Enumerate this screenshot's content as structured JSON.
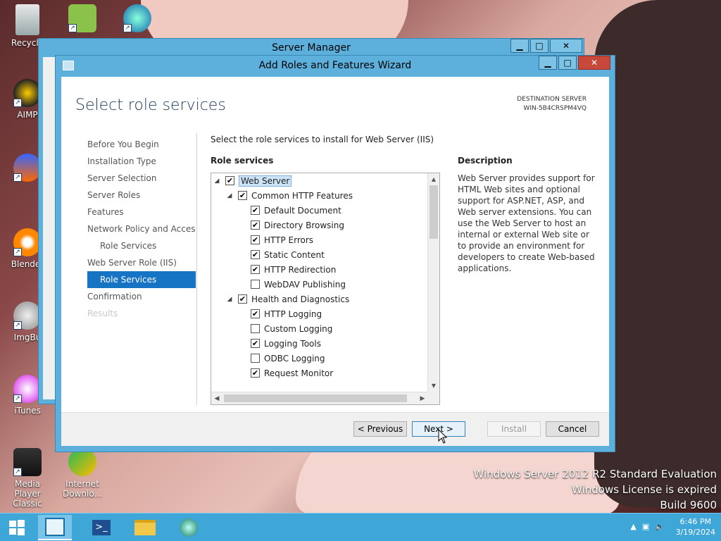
{
  "desktop": {
    "icons": [
      {
        "label": "Recycle",
        "icon": "recycle-bin-icon"
      },
      {
        "label": "AIMP",
        "icon": "aimp-icon"
      },
      {
        "label": "",
        "icon": "audacity-icon"
      },
      {
        "label": "Blender",
        "icon": "blender-icon"
      },
      {
        "label": "ImgBu",
        "icon": "imgburn-icon"
      },
      {
        "label": "iTunes",
        "icon": "itunes-icon"
      },
      {
        "label": "Media Player Classic",
        "icon": "media-player-classic-icon"
      },
      {
        "label": "Internet Downlo...",
        "icon": "internet-download-manager-icon"
      }
    ],
    "watermark": [
      "Windows Server 2012 R2 Standard Evaluation",
      "Windows License is expired",
      "Build 9600"
    ]
  },
  "server_manager": {
    "title": "Server Manager"
  },
  "wizard": {
    "title": "Add Roles and Features Wizard",
    "heading": "Select role services",
    "destination_label": "DESTINATION SERVER",
    "destination_server": "WIN-5B4CRSPM4VQ",
    "instruction": "Select the role services to install for Web Server (IIS)",
    "role_services_label": "Role services",
    "description_label": "Description",
    "description": "Web Server provides support for HTML Web sites and optional support for ASP.NET, ASP, and Web server extensions. You can use the Web Server to host an internal or external Web site or to provide an environment for developers to create Web-based applications.",
    "nav": [
      {
        "label": "Before You Begin",
        "state": "normal"
      },
      {
        "label": "Installation Type",
        "state": "normal"
      },
      {
        "label": "Server Selection",
        "state": "normal"
      },
      {
        "label": "Server Roles",
        "state": "normal"
      },
      {
        "label": "Features",
        "state": "normal"
      },
      {
        "label": "Network Policy and Acces...",
        "state": "normal"
      },
      {
        "label": "Role Services",
        "state": "sub"
      },
      {
        "label": "Web Server Role (IIS)",
        "state": "normal"
      },
      {
        "label": "Role Services",
        "state": "active"
      },
      {
        "label": "Confirmation",
        "state": "normal"
      },
      {
        "label": "Results",
        "state": "disabled"
      }
    ],
    "tree": [
      {
        "label": "Web Server",
        "level": 0,
        "checked": true,
        "expander": true,
        "selected": true
      },
      {
        "label": "Common HTTP Features",
        "level": 1,
        "checked": true,
        "expander": true
      },
      {
        "label": "Default Document",
        "level": 2,
        "checked": true
      },
      {
        "label": "Directory Browsing",
        "level": 2,
        "checked": true
      },
      {
        "label": "HTTP Errors",
        "level": 2,
        "checked": true
      },
      {
        "label": "Static Content",
        "level": 2,
        "checked": true
      },
      {
        "label": "HTTP Redirection",
        "level": 2,
        "checked": true
      },
      {
        "label": "WebDAV Publishing",
        "level": 2,
        "checked": false
      },
      {
        "label": "Health and Diagnostics",
        "level": 1,
        "checked": true,
        "expander": true
      },
      {
        "label": "HTTP Logging",
        "level": 2,
        "checked": true
      },
      {
        "label": "Custom Logging",
        "level": 2,
        "checked": false
      },
      {
        "label": "Logging Tools",
        "level": 2,
        "checked": true
      },
      {
        "label": "ODBC Logging",
        "level": 2,
        "checked": false
      },
      {
        "label": "Request Monitor",
        "level": 2,
        "checked": true
      }
    ],
    "buttons": {
      "previous": "< Previous",
      "next": "Next >",
      "install": "Install",
      "cancel": "Cancel"
    }
  },
  "taskbar": {
    "time": "6:46 PM",
    "date": "3/19/2024"
  }
}
